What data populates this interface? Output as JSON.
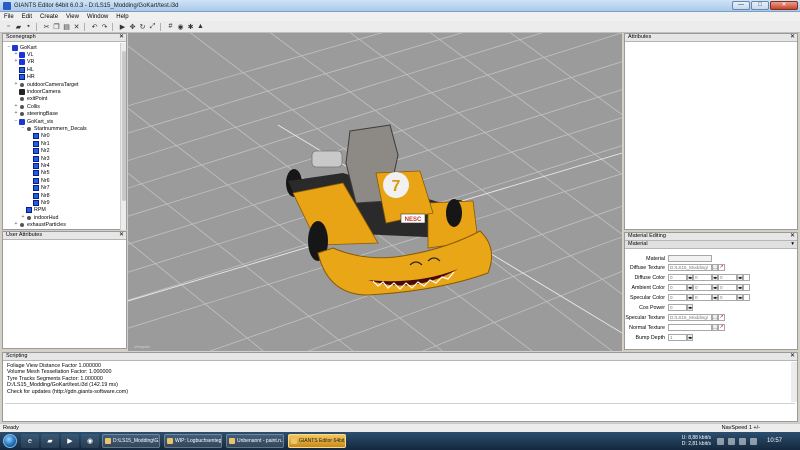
{
  "window": {
    "title": "GIANTS Editor 64bit 6.0.3 - D:/LS15_Modding/GoKart/test.i3d",
    "min": "—",
    "max": "□",
    "close": "✕"
  },
  "menu": [
    "File",
    "Edit",
    "Create",
    "View",
    "Window",
    "Help"
  ],
  "scenegraph": {
    "title": "Scenegraph",
    "close": "✕",
    "items": [
      {
        "label": "GoKart",
        "icon": "transform-group-icon",
        "expander": "−"
      },
      {
        "label": "VL",
        "icon": "transform-group-icon",
        "expander": "+"
      },
      {
        "label": "VR",
        "icon": "transform-group-icon",
        "expander": "+"
      },
      {
        "label": "HL",
        "icon": "shape-icon",
        "expander": ""
      },
      {
        "label": "HR",
        "icon": "shape-icon",
        "expander": ""
      },
      {
        "label": "outdoorCameraTarget",
        "icon": "point-icon",
        "expander": "+"
      },
      {
        "label": "indoorCamera",
        "icon": "camera-icon",
        "expander": ""
      },
      {
        "label": "exitPoint",
        "icon": "point-icon",
        "expander": ""
      },
      {
        "label": "Collis",
        "icon": "point-icon",
        "expander": "+"
      },
      {
        "label": "steeringBase",
        "icon": "point-icon",
        "expander": "+"
      },
      {
        "label": "GoKart_vis",
        "icon": "transform-group-icon",
        "expander": "−"
      },
      {
        "label": "Startnummern_Decals",
        "icon": "point-icon",
        "expander": "−"
      },
      {
        "label": "Nr0",
        "icon": "shape-icon",
        "expander": ""
      },
      {
        "label": "Nr1",
        "icon": "shape-icon",
        "expander": ""
      },
      {
        "label": "Nr2",
        "icon": "shape-icon",
        "expander": ""
      },
      {
        "label": "Nr3",
        "icon": "shape-icon",
        "expander": ""
      },
      {
        "label": "Nr4",
        "icon": "shape-icon",
        "expander": ""
      },
      {
        "label": "Nr5",
        "icon": "shape-icon",
        "expander": ""
      },
      {
        "label": "Nr6",
        "icon": "shape-icon",
        "expander": ""
      },
      {
        "label": "Nr7",
        "icon": "shape-icon",
        "expander": ""
      },
      {
        "label": "Nr8",
        "icon": "shape-icon",
        "expander": ""
      },
      {
        "label": "Nr9",
        "icon": "shape-icon",
        "expander": ""
      },
      {
        "label": "RPM",
        "icon": "shape-icon",
        "expander": ""
      },
      {
        "label": "indoorHud",
        "icon": "point-icon",
        "expander": "+"
      },
      {
        "label": "exhaustParticles",
        "icon": "point-icon",
        "expander": "+"
      }
    ]
  },
  "user_attributes": {
    "title": "User Attributes",
    "close": "✕"
  },
  "attributes": {
    "title": "Attributes",
    "close": "✕"
  },
  "material_editing": {
    "title": "Material Editing",
    "close": "✕",
    "sub": "Material",
    "sub_arrow": "▾",
    "rows": {
      "material": "Material",
      "diffuse_texture": "Diffuse Texture",
      "diffuse_texture_value": "D:/LS15_Modding/",
      "diffuse_color": "Diffuse Color",
      "ambient_color": "Ambient Color",
      "specular_color": "Specular Color",
      "cos_power": "Cos Power",
      "specular_texture": "Specular Texture",
      "specular_texture_value": "D:/LS15_Modding/",
      "normal_texture": "Normal Texture",
      "bump_depth": "Bump Depth",
      "zero": "0",
      "one": "1",
      "stepper": "◂▸",
      "browse": "...",
      "clear": "↗"
    }
  },
  "viewport": {
    "corner_text": "Viewport",
    "kart_number": "7",
    "front_label": "NESC"
  },
  "scripting": {
    "title": "Scripting",
    "close": "✕",
    "lines": [
      "Foliage View Distance Factor 1.000000",
      "Volume Mesh Tessellation Factor: 1.000000",
      "Tyre Tracks Segments Factor: 1.000000",
      "D:/LS15_Modding/GoKart/test.i3d (142.19 ms)",
      "Check for updates (http://gdn.giants-software.com)"
    ]
  },
  "status": {
    "left": "Ready",
    "right": "NavSpeed 1 +/-"
  },
  "taskbar": {
    "tasks": [
      {
        "label": "D:\\LS15_Modding\\G...",
        "active": false
      },
      {
        "label": "WIP: Logbuchsenteg...",
        "active": false
      },
      {
        "label": "Unbenannt - paint.n...",
        "active": false
      },
      {
        "label": "GIANTS Editor 64bit...",
        "active": true
      }
    ],
    "net_up": "8,88 kbit/s",
    "net_down": "2,81 kbit/s",
    "net_up_label": "U:",
    "net_down_label": "D:",
    "clock": "10:57"
  }
}
